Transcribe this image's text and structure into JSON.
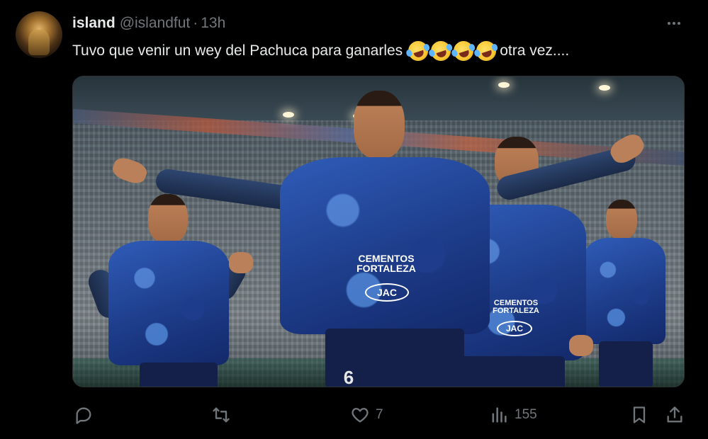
{
  "tweet": {
    "display_name": "island",
    "handle": "@islandfut",
    "separator": "·",
    "time": "13h",
    "text_before_emoji": "Tuvo que venir un wey del Pachuca para ganarles",
    "emoji": [
      "rolling-on-floor-laughing",
      "rolling-on-floor-laughing",
      "rolling-on-floor-laughing",
      "rolling-on-floor-laughing"
    ],
    "text_after_emoji": "otra vez...."
  },
  "media": {
    "description_icon": "photo",
    "shirt_sponsor_line1": "CEMENTOS",
    "shirt_sponsor_line2": "FORTALEZA",
    "shirt_badge": "JAC",
    "shorts_number": "6"
  },
  "actions": {
    "reply_count": "",
    "repost_count": "",
    "like_count": "7",
    "view_count": "155"
  },
  "colors": {
    "background": "#000000",
    "text_primary": "#e7e9ea",
    "text_secondary": "#71767b"
  }
}
